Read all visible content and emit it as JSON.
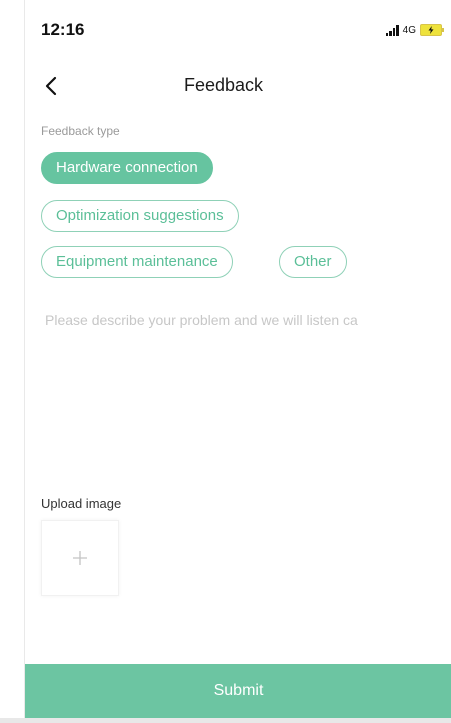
{
  "status_bar": {
    "time": "12:16",
    "network": "4G"
  },
  "nav": {
    "title": "Feedback"
  },
  "feedback_type": {
    "label": "Feedback type",
    "options": [
      {
        "label": "Hardware connection",
        "selected": true
      },
      {
        "label": "Optimization suggestions",
        "selected": false
      },
      {
        "label": "Equipment maintenance",
        "selected": false
      },
      {
        "label": "Other",
        "selected": false
      }
    ]
  },
  "description": {
    "placeholder": "Please describe your problem and we will listen ca",
    "value": ""
  },
  "upload": {
    "label": "Upload image"
  },
  "submit": {
    "label": "Submit"
  },
  "colors": {
    "accent": "#66c4a0",
    "chip_border": "#8fd1b7",
    "chip_text": "#5bbf98",
    "placeholder": "#c7c7c7"
  },
  "icons": {
    "back": "chevron-left-icon",
    "add": "plus-icon",
    "battery": "battery-charging-icon",
    "signal": "signal-icon"
  }
}
